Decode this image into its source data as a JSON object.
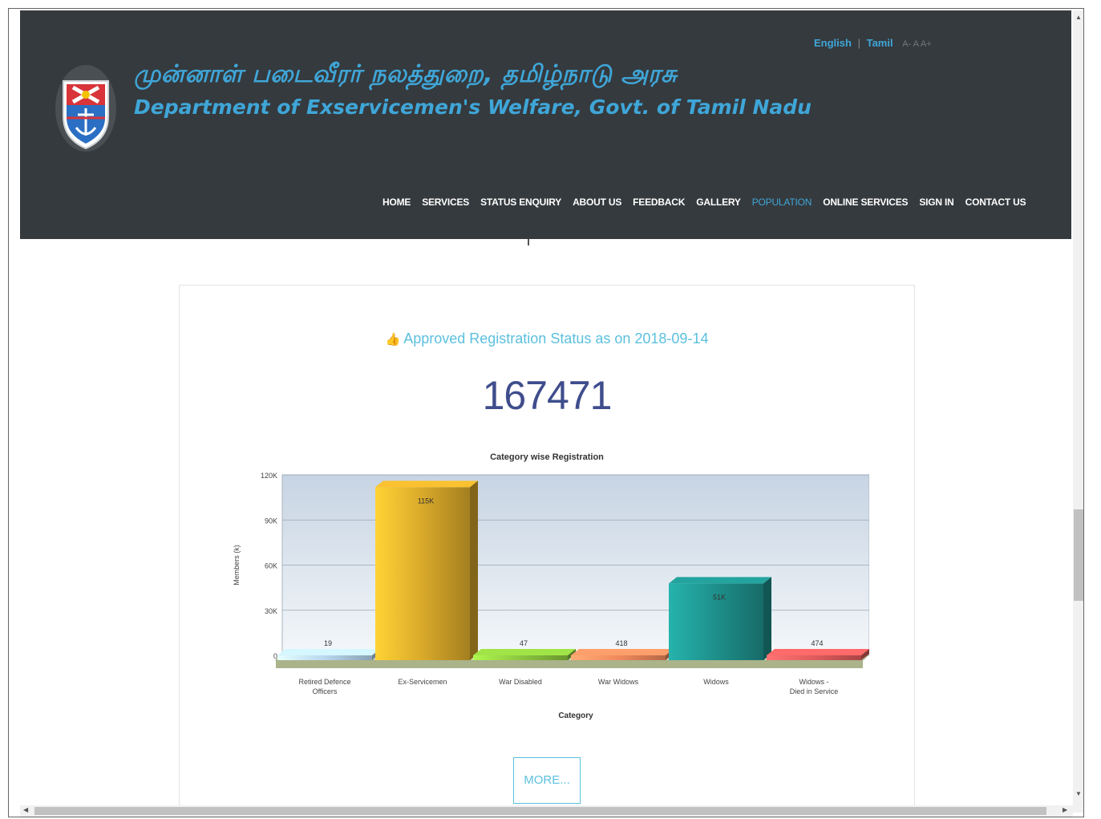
{
  "header": {
    "title_tamil": "முன்னாள் படைவீரர் நலத்துறை, தமிழ்நாடு அரசு",
    "title_english": "Department of Exservicemen's Welfare, Govt. of Tamil Nadu",
    "lang_english": "English",
    "lang_tamil": "Tamil",
    "font_size_controls": "A- A A+"
  },
  "nav": {
    "items": [
      {
        "label": "HOME"
      },
      {
        "label": "SERVICES"
      },
      {
        "label": "STATUS ENQUIRY"
      },
      {
        "label": "ABOUT US"
      },
      {
        "label": "FEEDBACK"
      },
      {
        "label": "GALLERY"
      },
      {
        "label": "POPULATION"
      },
      {
        "label": "ONLINE SERVICES"
      },
      {
        "label": "SIGN IN"
      },
      {
        "label": "CONTACT US"
      }
    ],
    "active": "POPULATION"
  },
  "panel": {
    "status_text": "Approved Registration Status as on 2018-09-14",
    "total": "167471",
    "more_label": "MORE..."
  },
  "chart_data": {
    "type": "bar",
    "title": "Category wise Registration",
    "xlabel": "Category",
    "ylabel": "Members (k)",
    "ylim": [
      0,
      120000
    ],
    "y_ticks": [
      "0",
      "30K",
      "60K",
      "90K",
      "120K"
    ],
    "categories": [
      "Retired Defence Officers",
      "Ex-Servicemen",
      "War Disabled",
      "War Widows",
      "Widows",
      "Widows - Died in Service"
    ],
    "values": [
      19,
      115000,
      47,
      418,
      51000,
      474
    ],
    "value_labels": [
      "19",
      "115K",
      "47",
      "418",
      "51K",
      "474"
    ],
    "colors": [
      "#b9d7ee",
      "#d9a92a",
      "#8cc63f",
      "#f08a5d",
      "#1e8f8a",
      "#e05c5c"
    ],
    "grid": true,
    "style": "3d"
  },
  "colors": {
    "header_bg": "#353a3e",
    "accent": "#3fa6d8",
    "total_number": "#3f4d8c"
  }
}
